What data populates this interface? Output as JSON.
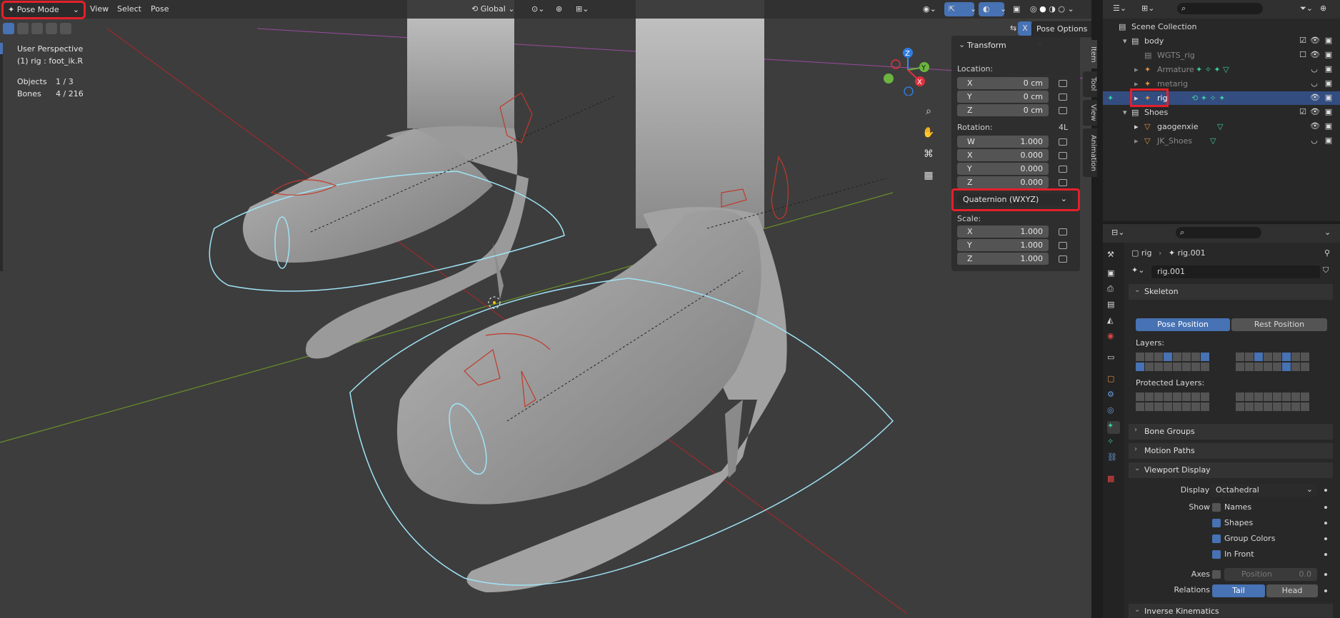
{
  "header": {
    "mode_label": "Pose Mode",
    "menus": [
      "View",
      "Select",
      "Pose"
    ],
    "orientation": "Global",
    "pose_options_label": "Pose Options",
    "x_mirror": "X"
  },
  "viewport": {
    "view_name": "User Perspective",
    "active_label": "(1) rig : foot_ik.R",
    "objects_label": "Objects",
    "objects_value": "1 / 3",
    "bones_label": "Bones",
    "bones_value": "4 / 216",
    "gizmo": {
      "x": "X",
      "y": "Y",
      "z": "Z"
    }
  },
  "side_tabs": [
    "Item",
    "Tool",
    "View",
    "Animation"
  ],
  "transform": {
    "title": "Transform",
    "location_label": "Location:",
    "location": [
      {
        "axis": "X",
        "value": "0 cm"
      },
      {
        "axis": "Y",
        "value": "0 cm"
      },
      {
        "axis": "Z",
        "value": "0 cm"
      }
    ],
    "rotation_label": "Rotation:",
    "rotation_mode_short": "4L",
    "rotation": [
      {
        "axis": "W",
        "value": "1.000"
      },
      {
        "axis": "X",
        "value": "0.000"
      },
      {
        "axis": "Y",
        "value": "0.000"
      },
      {
        "axis": "Z",
        "value": "0.000"
      }
    ],
    "rotation_mode": "Quaternion (WXYZ)",
    "scale_label": "Scale:",
    "scale": [
      {
        "axis": "X",
        "value": "1.000"
      },
      {
        "axis": "Y",
        "value": "1.000"
      },
      {
        "axis": "Z",
        "value": "1.000"
      }
    ]
  },
  "outliner": {
    "rows": [
      {
        "label": "Scene Collection"
      },
      {
        "label": "body"
      },
      {
        "label": "WGTS_rig"
      },
      {
        "label": "Armature"
      },
      {
        "label": "metarig"
      },
      {
        "label": "rig"
      },
      {
        "label": "Shoes"
      },
      {
        "label": "gaogenxie"
      },
      {
        "label": "JK_Shoes"
      }
    ]
  },
  "properties": {
    "breadcrumb_object": "rig",
    "breadcrumb_data": "rig.001",
    "data_name": "rig.001",
    "skeleton": {
      "title": "Skeleton",
      "pose_position": "Pose Position",
      "rest_position": "Rest Position",
      "layers_label": "Layers:",
      "protected_label": "Protected Layers:"
    },
    "bone_groups": "Bone Groups",
    "motion_paths": "Motion Paths",
    "viewport_display": {
      "title": "Viewport Display",
      "display_as_label": "Display As",
      "display_as_value": "Octahedral",
      "show_label": "Show",
      "names": "Names",
      "shapes": "Shapes",
      "group_colors": "Group Colors",
      "in_front": "In Front",
      "axes_label": "Axes",
      "position_label": "Position",
      "position_value": "0.0",
      "relations_label": "Relations",
      "tail": "Tail",
      "head": "Head"
    },
    "inverse_kinematics": "Inverse Kinematics"
  },
  "colors": {
    "highlight": "#e4202a",
    "accent": "#4772b3",
    "ik_widget": "#9fe3f5"
  }
}
